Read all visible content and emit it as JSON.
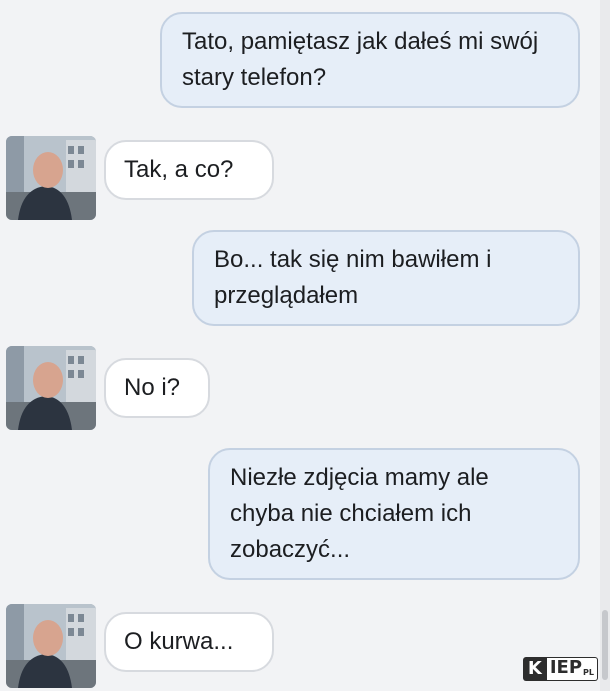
{
  "messages": [
    {
      "sender": "user",
      "text": "Tato, pamiętasz jak dałeś mi swój stary telefon?"
    },
    {
      "sender": "contact",
      "text": "Tak, a co?"
    },
    {
      "sender": "user",
      "text": "Bo... tak się nim bawiłem i przeglądałem"
    },
    {
      "sender": "contact",
      "text": "No i?"
    },
    {
      "sender": "user",
      "text": "Niezłe zdjęcia mamy ale chyba nie chciałem ich zobaczyć..."
    },
    {
      "sender": "contact",
      "text": "O kurwa..."
    }
  ],
  "watermark": {
    "k": "K",
    "main": "IEP",
    "suffix": "PL"
  },
  "colors": {
    "background": "#f2f3f5",
    "outgoing_bubble": "#e6eef8",
    "incoming_bubble": "#ffffff",
    "text": "#1c1e21"
  },
  "icons": {
    "contact_avatar": "contact-avatar-photo"
  }
}
